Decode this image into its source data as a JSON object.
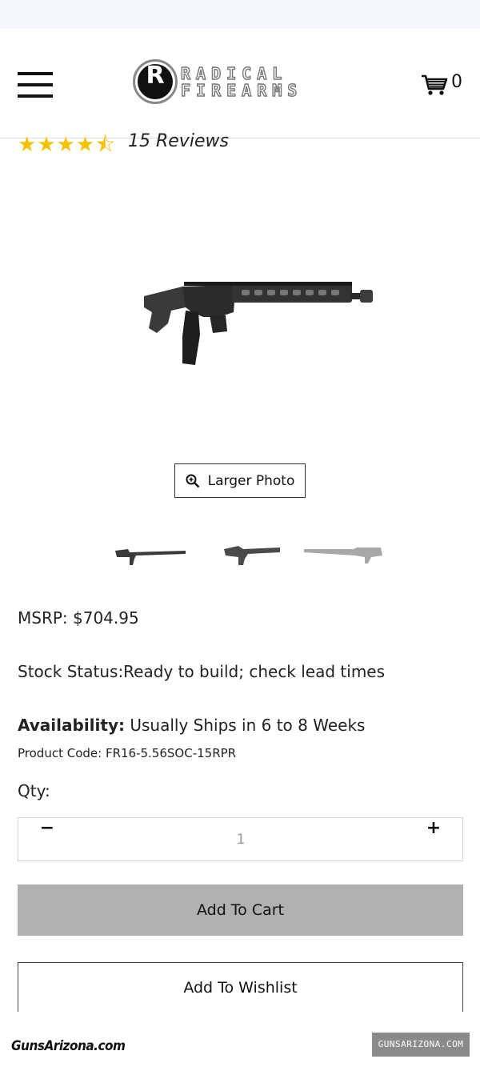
{
  "header": {
    "brand_line1": "RADICAL",
    "brand_line2": "FIREARMS",
    "logo_mark": "R",
    "cart_count": "0",
    "menu_icon": "hamburger-icon",
    "cart_icon": "shopping-cart-icon"
  },
  "rating": {
    "stars": "★★★★⯪",
    "value": 4.5,
    "max": 5,
    "reviews_label": "15 Reviews",
    "star_color": "#f6c200"
  },
  "gallery": {
    "larger_photo_label": "Larger Photo",
    "zoom_icon": "magnify-plus-icon",
    "thumbnail_count": 3
  },
  "product": {
    "msrp": "MSRP: $704.95",
    "stock_status": "Stock Status:Ready to build; check lead times",
    "availability_label": "Availability:",
    "availability_value": " Usually Ships in 6 to 8 Weeks",
    "product_code": "Product Code:  FR16-5.56SOC-15RPR"
  },
  "quantity": {
    "label": "Qty:",
    "value": "1",
    "decrement": "−",
    "increment": "+"
  },
  "actions": {
    "add_to_cart": "Add To Cart",
    "add_to_wishlist": "Add To Wishlist",
    "cart_button_color": "#b0b0b0"
  },
  "watermarks": {
    "left": "GunsArizona.com",
    "right": "GUNSARIZONA.COM"
  }
}
